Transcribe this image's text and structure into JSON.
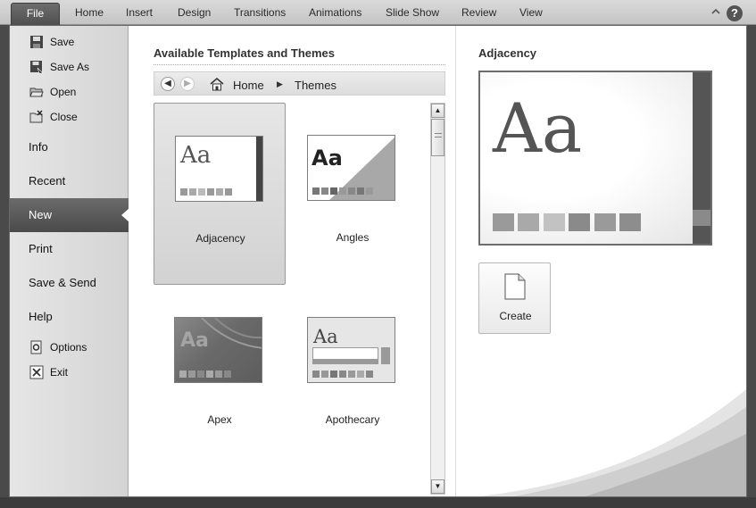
{
  "ribbon": {
    "file_tab": "File",
    "tabs": [
      "Home",
      "Insert",
      "Design",
      "Transitions",
      "Animations",
      "Slide Show",
      "Review",
      "View"
    ]
  },
  "nav": {
    "commands": [
      {
        "label": "Save",
        "icon": "floppy-disk-icon"
      },
      {
        "label": "Save As",
        "icon": "save-as-icon"
      },
      {
        "label": "Open",
        "icon": "open-folder-icon"
      },
      {
        "label": "Close",
        "icon": "close-folder-icon"
      }
    ],
    "sections": [
      "Info",
      "Recent",
      "New",
      "Print",
      "Save & Send",
      "Help"
    ],
    "active_section": "New",
    "footer": [
      {
        "label": "Options",
        "icon": "options-icon"
      },
      {
        "label": "Exit",
        "icon": "exit-icon"
      }
    ]
  },
  "middle": {
    "title": "Available Templates and Themes",
    "breadcrumb": {
      "home": "Home",
      "current": "Themes"
    },
    "themes": [
      {
        "name": "Adjacency",
        "selected": true
      },
      {
        "name": "Angles",
        "selected": false
      },
      {
        "name": "Apex",
        "selected": false
      },
      {
        "name": "Apothecary",
        "selected": false
      }
    ],
    "thumbnail_text": "Aa"
  },
  "preview": {
    "title": "Adjacency",
    "sample_text": "Aa",
    "create_label": "Create"
  },
  "colors": {
    "file_tab": "#5a5a5a",
    "active_nav": "#5b5b5b",
    "selected_tile": "#dcdcdc"
  }
}
